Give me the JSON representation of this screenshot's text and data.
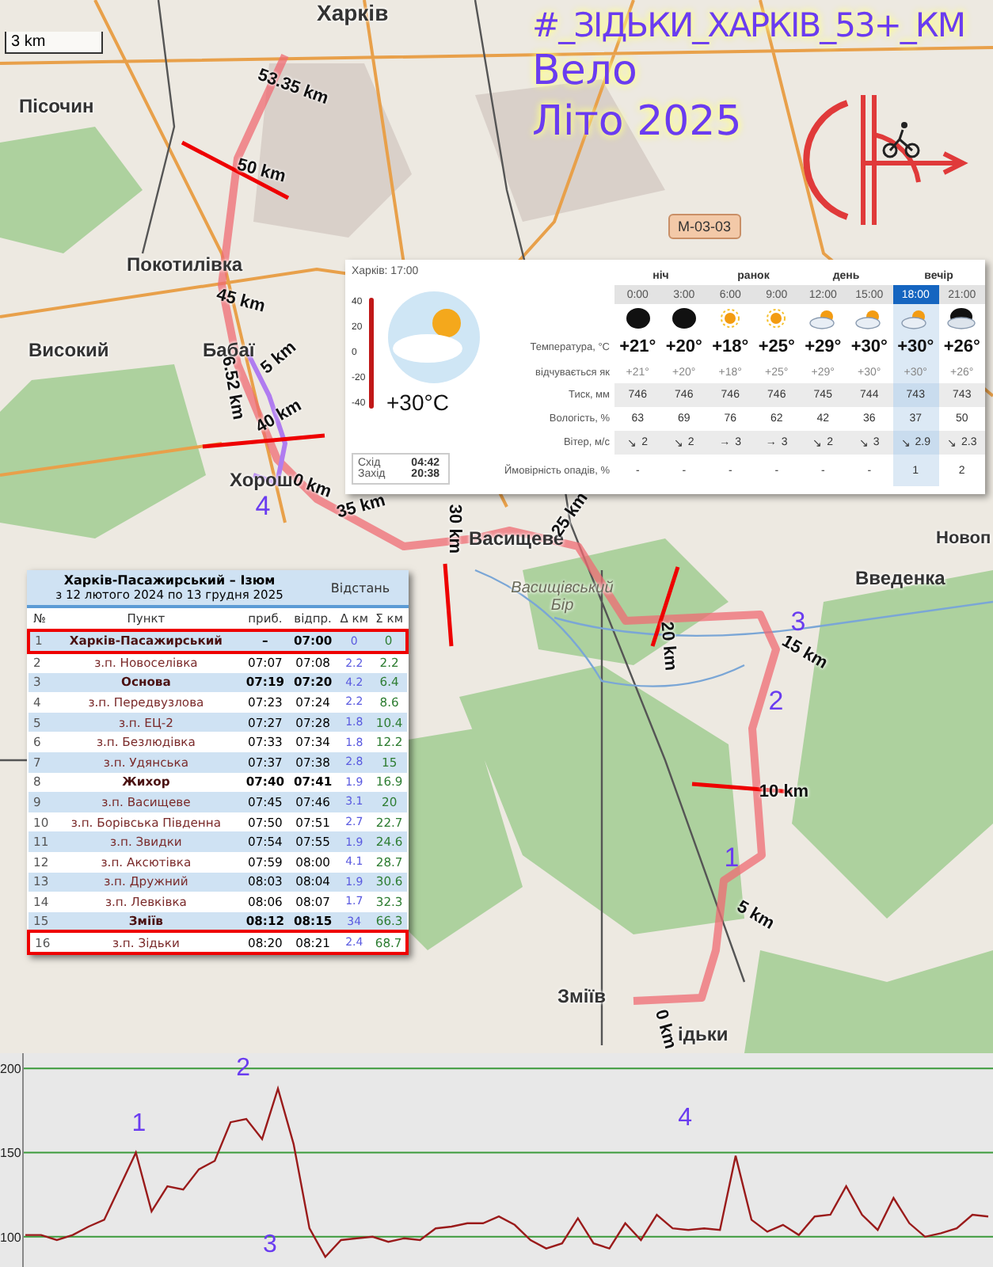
{
  "map": {
    "scale": "3 km",
    "road_sign": "M-03-03",
    "title": "#_ЗІДЬКИ_ХАРКІВ_53+_КМ",
    "subtitle": "Вело",
    "season": "Літо 2025",
    "places": [
      {
        "name": "Харків",
        "kind": "city"
      },
      {
        "name": "Пісочин",
        "kind": "town"
      },
      {
        "name": "Покотилівка",
        "kind": "town"
      },
      {
        "name": "Високий",
        "kind": "town"
      },
      {
        "name": "Бабаї",
        "kind": "town"
      },
      {
        "name": "Хорош",
        "kind": "town"
      },
      {
        "name": "Васищеве",
        "kind": "town"
      },
      {
        "name": "Васищівський Бір",
        "kind": "forest"
      },
      {
        "name": "Введенка",
        "kind": "town"
      },
      {
        "name": "Новоп",
        "kind": "town"
      },
      {
        "name": "Зміїв",
        "kind": "town"
      },
      {
        "name": "ідьки",
        "kind": "town"
      }
    ],
    "km_labels": [
      "53.35 km",
      "50 km",
      "45 km",
      "5 km",
      "6.52 km",
      "40 km",
      "0 km",
      "35 km",
      "30 km",
      "25 km",
      "20 km",
      "15 km",
      "10 km",
      "5 km",
      "0 km"
    ],
    "route_markers": [
      "1",
      "2",
      "3",
      "4"
    ]
  },
  "weather": {
    "location_time": "Харків: 17:00",
    "current_temp": "+30°C",
    "thermometer_scale": [
      "40",
      "20",
      "0",
      "-20",
      "-40"
    ],
    "sunrise_label": "Схід",
    "sunrise": "04:42",
    "sunset_label": "Захід",
    "sunset": "20:38",
    "row_labels": [
      "Температура, °C",
      "відчувається як",
      "Тиск, мм",
      "Вологість, %",
      "Вітер, м/с",
      "Ймовірність опадів, %"
    ],
    "periods": [
      "ніч",
      "ранок",
      "день",
      "вечір"
    ],
    "columns": [
      {
        "time": "0:00",
        "kind": "moon",
        "temp": "+21°",
        "feels": "+21°",
        "pressure": "746",
        "humidity": "63",
        "wind_arrow": "↘",
        "wind": "2",
        "precip": "-",
        "selected": false
      },
      {
        "time": "3:00",
        "kind": "moon",
        "temp": "+20°",
        "feels": "+20°",
        "pressure": "746",
        "humidity": "69",
        "wind_arrow": "↘",
        "wind": "2",
        "precip": "-",
        "selected": false
      },
      {
        "time": "6:00",
        "kind": "sun",
        "temp": "+18°",
        "feels": "+18°",
        "pressure": "746",
        "humidity": "76",
        "wind_arrow": "→",
        "wind": "3",
        "precip": "-",
        "selected": false
      },
      {
        "time": "9:00",
        "kind": "sun",
        "temp": "+25°",
        "feels": "+25°",
        "pressure": "746",
        "humidity": "62",
        "wind_arrow": "→",
        "wind": "3",
        "precip": "-",
        "selected": false
      },
      {
        "time": "12:00",
        "kind": "sun-cloud",
        "temp": "+29°",
        "feels": "+29°",
        "pressure": "745",
        "humidity": "42",
        "wind_arrow": "↘",
        "wind": "2",
        "precip": "-",
        "selected": false
      },
      {
        "time": "15:00",
        "kind": "sun-cloud",
        "temp": "+30°",
        "feels": "+30°",
        "pressure": "744",
        "humidity": "36",
        "wind_arrow": "↘",
        "wind": "3",
        "precip": "-",
        "selected": false
      },
      {
        "time": "18:00",
        "kind": "sun-cloud",
        "temp": "+30°",
        "feels": "+30°",
        "pressure": "743",
        "humidity": "37",
        "wind_arrow": "↘",
        "wind": "2.9",
        "precip": "1",
        "selected": true
      },
      {
        "time": "21:00",
        "kind": "moon-cloud",
        "temp": "+26°",
        "feels": "+26°",
        "pressure": "743",
        "humidity": "50",
        "wind_arrow": "↘",
        "wind": "2.3",
        "precip": "2",
        "selected": false
      }
    ]
  },
  "timetable": {
    "title": "Харків-Пасажирський – Ізюм",
    "period": "з 12 лютого 2024 по 13 грудня 2025",
    "distance_header": "Відстань",
    "columns": [
      "№",
      "Пункт",
      "приб.",
      "відпр.",
      "Δ км",
      "Σ км"
    ],
    "rows": [
      {
        "no": "1",
        "stop": "Харків-Пасажирський",
        "arr": "–",
        "dep": "07:00",
        "delta": "0",
        "total": "0",
        "kind": "major",
        "highlighted": true
      },
      {
        "no": "2",
        "stop": "з.п. Новоселівка",
        "arr": "07:07",
        "dep": "07:08",
        "delta": "2.2",
        "total": "2.2",
        "kind": "stop",
        "highlighted": false
      },
      {
        "no": "3",
        "stop": "Основа",
        "arr": "07:19",
        "dep": "07:20",
        "delta": "4.2",
        "total": "6.4",
        "kind": "major",
        "highlighted": false
      },
      {
        "no": "4",
        "stop": "з.п. Передвузлова",
        "arr": "07:23",
        "dep": "07:24",
        "delta": "2.2",
        "total": "8.6",
        "kind": "stop",
        "highlighted": false
      },
      {
        "no": "5",
        "stop": "з.п. ЕЦ-2",
        "arr": "07:27",
        "dep": "07:28",
        "delta": "1.8",
        "total": "10.4",
        "kind": "stop",
        "highlighted": false
      },
      {
        "no": "6",
        "stop": "з.п. Безлюдівка",
        "arr": "07:33",
        "dep": "07:34",
        "delta": "1.8",
        "total": "12.2",
        "kind": "stop",
        "highlighted": false
      },
      {
        "no": "7",
        "stop": "з.п. Удянська",
        "arr": "07:37",
        "dep": "07:38",
        "delta": "2.8",
        "total": "15",
        "kind": "stop",
        "highlighted": false
      },
      {
        "no": "8",
        "stop": "Жихор",
        "arr": "07:40",
        "dep": "07:41",
        "delta": "1.9",
        "total": "16.9",
        "kind": "major",
        "highlighted": false
      },
      {
        "no": "9",
        "stop": "з.п. Васищеве",
        "arr": "07:45",
        "dep": "07:46",
        "delta": "3.1",
        "total": "20",
        "kind": "stop",
        "highlighted": false
      },
      {
        "no": "10",
        "stop": "з.п. Борівська Південна",
        "arr": "07:50",
        "dep": "07:51",
        "delta": "2.7",
        "total": "22.7",
        "kind": "stop",
        "highlighted": false
      },
      {
        "no": "11",
        "stop": "з.п. Звидки",
        "arr": "07:54",
        "dep": "07:55",
        "delta": "1.9",
        "total": "24.6",
        "kind": "stop",
        "highlighted": false
      },
      {
        "no": "12",
        "stop": "з.п. Аксютівка",
        "arr": "07:59",
        "dep": "08:00",
        "delta": "4.1",
        "total": "28.7",
        "kind": "stop",
        "highlighted": false
      },
      {
        "no": "13",
        "stop": "з.п. Дружний",
        "arr": "08:03",
        "dep": "08:04",
        "delta": "1.9",
        "total": "30.6",
        "kind": "stop",
        "highlighted": false
      },
      {
        "no": "14",
        "stop": "з.п. Левківка",
        "arr": "08:06",
        "dep": "08:07",
        "delta": "1.7",
        "total": "32.3",
        "kind": "stop",
        "highlighted": false
      },
      {
        "no": "15",
        "stop": "Зміїв",
        "arr": "08:12",
        "dep": "08:15",
        "delta": "34",
        "total": "66.3",
        "kind": "major",
        "highlighted": false
      },
      {
        "no": "16",
        "stop": "з.п. Зідьки",
        "arr": "08:20",
        "dep": "08:21",
        "delta": "2.4",
        "total": "68.7",
        "kind": "stop",
        "highlighted": true
      }
    ]
  },
  "elevation": {
    "chart_data": {
      "type": "line",
      "yticks": [
        100,
        150,
        200
      ],
      "ylim": [
        82,
        209
      ],
      "grid": true,
      "series": [
        {
          "color": "#9a1b1b",
          "values": [
            101,
            101,
            98,
            101,
            106,
            110,
            130,
            150,
            115,
            130,
            128,
            140,
            145,
            168,
            170,
            158,
            188,
            155,
            105,
            88,
            98,
            99,
            100,
            97,
            99,
            98,
            105,
            106,
            108,
            108,
            112,
            107,
            98,
            93,
            96,
            111,
            96,
            93,
            108,
            98,
            113,
            105,
            104,
            105,
            104,
            148,
            110,
            103,
            107,
            101,
            112,
            113,
            130,
            113,
            104,
            123,
            108,
            100,
            102,
            105,
            113,
            112
          ]
        }
      ],
      "annotations": [
        "1",
        "2",
        "3",
        "4"
      ]
    }
  }
}
